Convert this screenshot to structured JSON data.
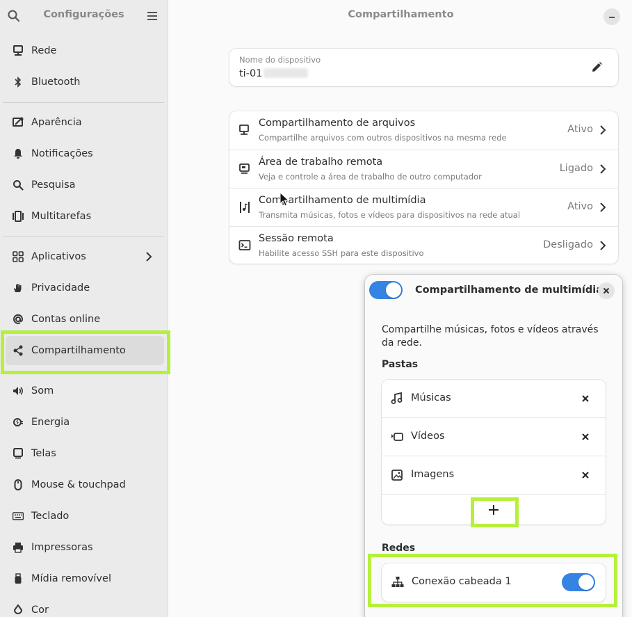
{
  "sidebar": {
    "title": "Configurações",
    "items": [
      {
        "label": "Rede",
        "icon": "network-icon"
      },
      {
        "label": "Bluetooth",
        "icon": "bluetooth-icon"
      },
      {
        "label": "Aparência",
        "icon": "appearance-icon"
      },
      {
        "label": "Notificações",
        "icon": "bell-icon"
      },
      {
        "label": "Pesquisa",
        "icon": "search-icon"
      },
      {
        "label": "Multitarefas",
        "icon": "multitasking-icon"
      },
      {
        "label": "Aplicativos",
        "icon": "apps-grid-icon"
      },
      {
        "label": "Privacidade",
        "icon": "hand-icon"
      },
      {
        "label": "Contas online",
        "icon": "at-icon"
      },
      {
        "label": "Compartilhamento",
        "icon": "share-icon"
      },
      {
        "label": "Som",
        "icon": "speaker-icon"
      },
      {
        "label": "Energia",
        "icon": "power-plug-icon"
      },
      {
        "label": "Telas",
        "icon": "display-icon"
      },
      {
        "label": "Mouse & touchpad",
        "icon": "mouse-icon"
      },
      {
        "label": "Teclado",
        "icon": "keyboard-icon"
      },
      {
        "label": "Impressoras",
        "icon": "printer-icon"
      },
      {
        "label": "Mídia removível",
        "icon": "usb-icon"
      },
      {
        "label": "Cor",
        "icon": "color-icon"
      }
    ],
    "active_item": "Compartilhamento"
  },
  "main": {
    "title": "Compartilhamento",
    "device_name": {
      "label": "Nome do dispositivo",
      "value": "ti-01"
    },
    "shares": [
      {
        "title": "Compartilhamento de arquivos",
        "subtitle": "Compartilhe arquivos com outros dispositivos na mesma rede",
        "status": "Ativo",
        "icon": "file-share-icon"
      },
      {
        "title": "Área de trabalho remota",
        "subtitle": "Veja e controle a área de trabalho de outro computador",
        "status": "Ligado",
        "icon": "remote-desktop-icon"
      },
      {
        "title": "Compartilhamento de multimídia",
        "subtitle": "Transmita músicas, fotos e vídeos para dispositivos na rede atual",
        "status": "Ativo",
        "icon": "media-share-icon"
      },
      {
        "title": "Sessão remota",
        "subtitle": "Habilite acesso SSH para este dispositivo",
        "status": "Desligado",
        "icon": "terminal-icon"
      }
    ]
  },
  "dialog": {
    "title": "Compartilhamento de multimídia",
    "enabled": true,
    "description": "Compartilhe músicas, fotos e vídeos através da rede.",
    "folders_heading": "Pastas",
    "folders": [
      {
        "label": "Músicas",
        "icon": "music-note-icon"
      },
      {
        "label": "Vídeos",
        "icon": "video-camera-icon"
      },
      {
        "label": "Imagens",
        "icon": "image-icon"
      }
    ],
    "networks_heading": "Redes",
    "networks": [
      {
        "label": "Conexão cabeada 1",
        "enabled": true
      }
    ]
  },
  "colors": {
    "accent": "#3584e4",
    "highlight": "#b5f03a"
  }
}
